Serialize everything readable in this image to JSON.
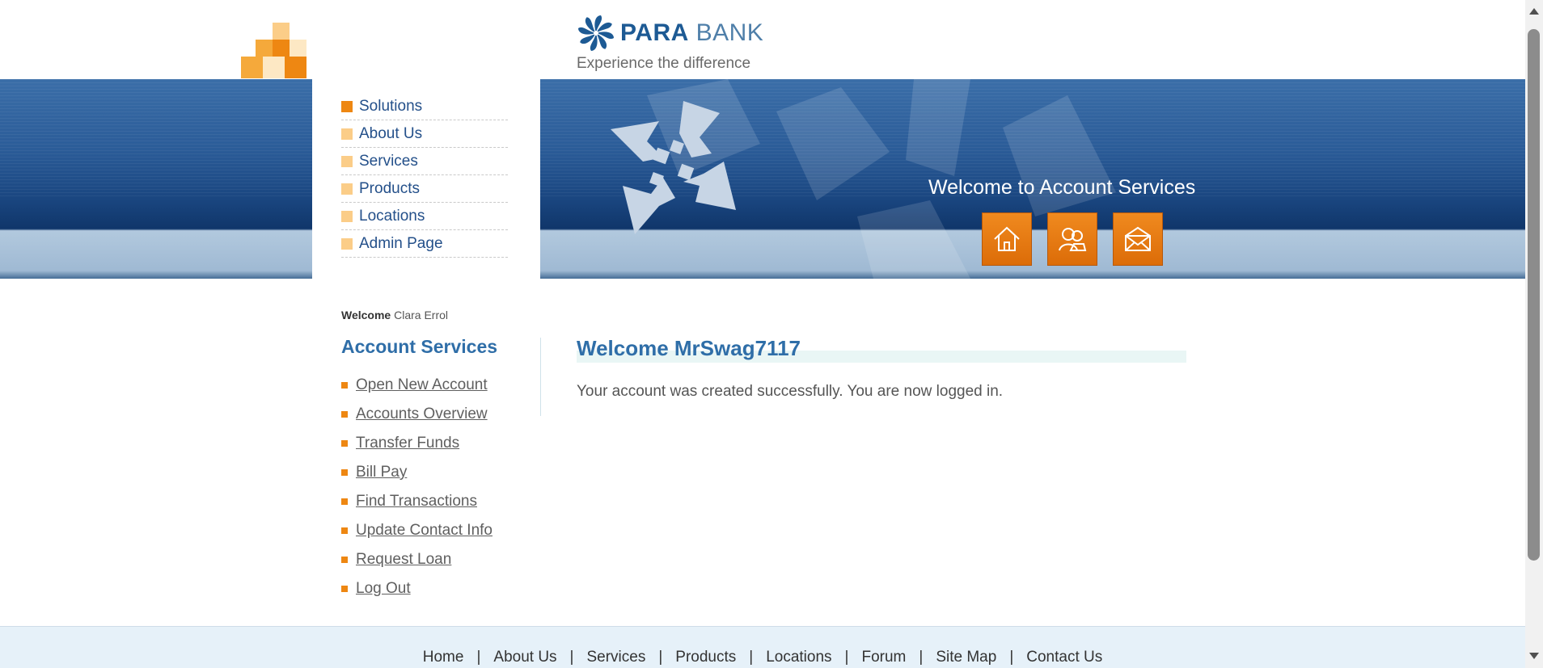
{
  "brand": {
    "name_bold": "PARA",
    "name_light": "BANK",
    "tagline": "Experience the difference"
  },
  "topnav": {
    "items": [
      {
        "label": "Solutions",
        "active": true
      },
      {
        "label": "About Us",
        "active": false
      },
      {
        "label": "Services",
        "active": false
      },
      {
        "label": "Products",
        "active": false
      },
      {
        "label": "Locations",
        "active": false
      },
      {
        "label": "Admin Page",
        "active": false
      }
    ]
  },
  "header": {
    "title": "Welcome to Account Services",
    "buttons": [
      {
        "icon": "home-icon"
      },
      {
        "icon": "about-icon"
      },
      {
        "icon": "contact-envelope-icon"
      }
    ]
  },
  "sidebar": {
    "welcome_label": "Welcome",
    "user_name": "Clara Errol",
    "title": "Account Services",
    "links": [
      "Open New Account",
      "Accounts Overview",
      "Transfer Funds",
      "Bill Pay",
      "Find Transactions",
      "Update Contact Info",
      "Request Loan",
      "Log Out"
    ]
  },
  "main": {
    "title": "Welcome MrSwag7117",
    "message": "Your account was created successfully. You are now logged in."
  },
  "footer": {
    "links": [
      "Home",
      "About Us",
      "Services",
      "Products",
      "Locations",
      "Forum",
      "Site Map",
      "Contact Us"
    ],
    "separator": "|"
  },
  "colors": {
    "brand_blue": "#2f6ea8",
    "accent_orange": "#ee8712",
    "header_band": "#1a4680",
    "footer_bg": "#e6f1f9"
  }
}
